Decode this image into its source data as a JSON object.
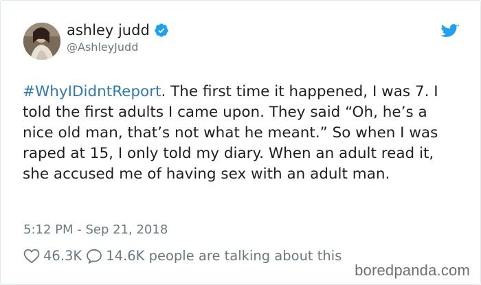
{
  "author": {
    "display_name": "ashley judd",
    "handle": "@AshleyJudd",
    "verified": true,
    "avatar_icon": "avatar-photo"
  },
  "tweet": {
    "hashtag": "#WhyIDidntReport",
    "body": ". The first time it happened, I was 7. I told the first adults I came upon. They said “Oh, he’s a nice old man, that’s not what he meant.” So when I was raped at 15, I only told my diary. When an adult read it, she accused me of having sex with an adult man.",
    "timestamp": "5:12 PM - Sep 21, 2018"
  },
  "stats": {
    "likes": "46.3K",
    "replies_label": "14.6K people are talking about this"
  },
  "watermark": "boredpanda.com",
  "colors": {
    "link_blue": "#2b7bb9",
    "verified_blue": "#1da1f2",
    "muted_gray": "#697882",
    "text_dark": "#1c2022"
  },
  "icons": {
    "brand": "twitter-bird-icon",
    "verified": "verified-badge-icon",
    "like": "heart-icon",
    "reply": "speech-bubble-icon"
  }
}
